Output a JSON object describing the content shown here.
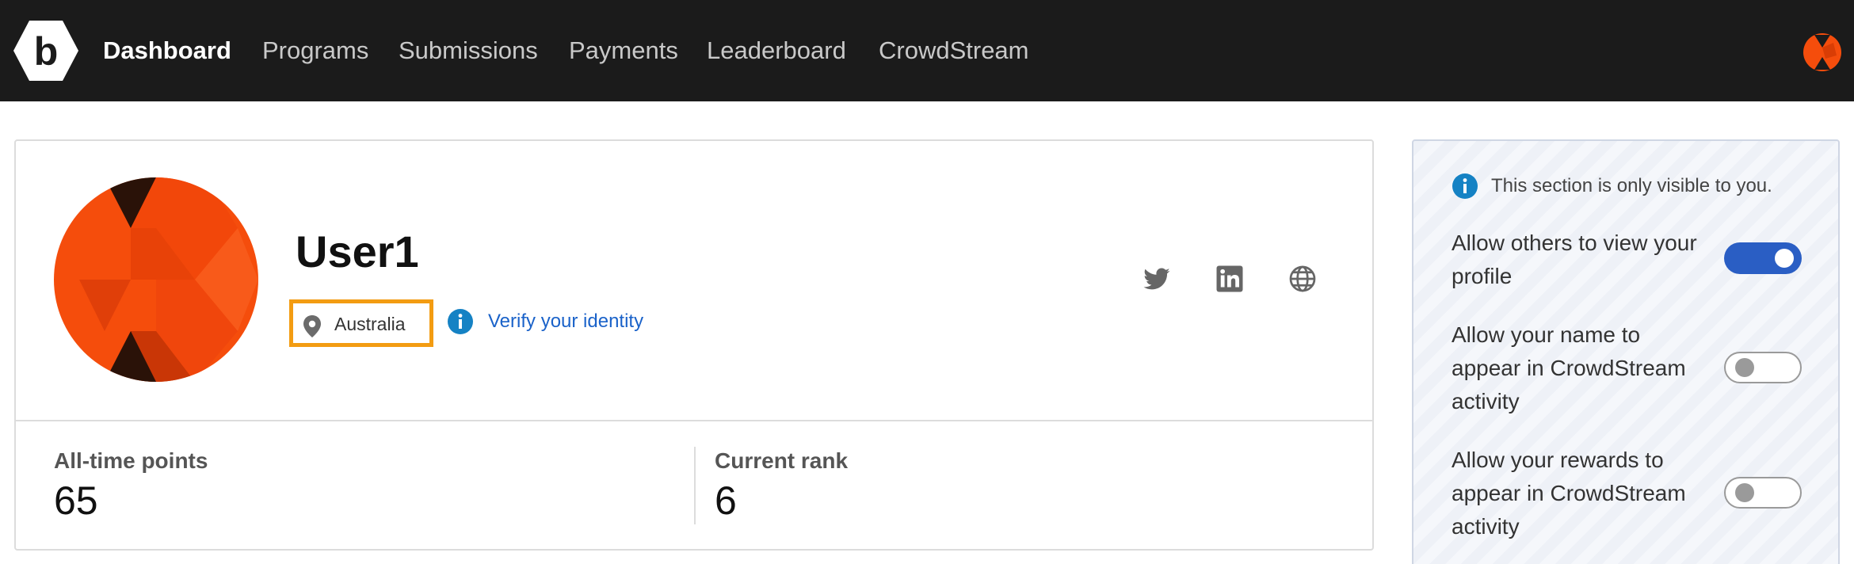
{
  "nav": {
    "items": [
      "Dashboard",
      "Programs",
      "Submissions",
      "Payments",
      "Leaderboard",
      "CrowdStream"
    ],
    "active_item": "Dashboard"
  },
  "profile": {
    "username": "User1",
    "location": "Australia",
    "verify_link": "Verify your identity",
    "social_icons": [
      "twitter-icon",
      "linkedin-icon",
      "globe-icon"
    ],
    "stats": [
      {
        "label": "All-time points",
        "value": "65"
      },
      {
        "label": "Current rank",
        "value": "6"
      }
    ]
  },
  "privacy": {
    "notice": "This section is only visible to you.",
    "settings": [
      {
        "label": "Allow others to view your profile",
        "enabled": true
      },
      {
        "label": "Allow your name to appear in CrowdStream activity",
        "enabled": false
      },
      {
        "label": "Allow your rewards to appear in CrowdStream activity",
        "enabled": false
      }
    ]
  },
  "colors": {
    "nav_background": "#1b1b1b",
    "accent_orange": "#f54d0c",
    "highlight_border": "#f39c12",
    "link_blue": "#1a62c9",
    "toggle_on": "#2a5ec4"
  }
}
